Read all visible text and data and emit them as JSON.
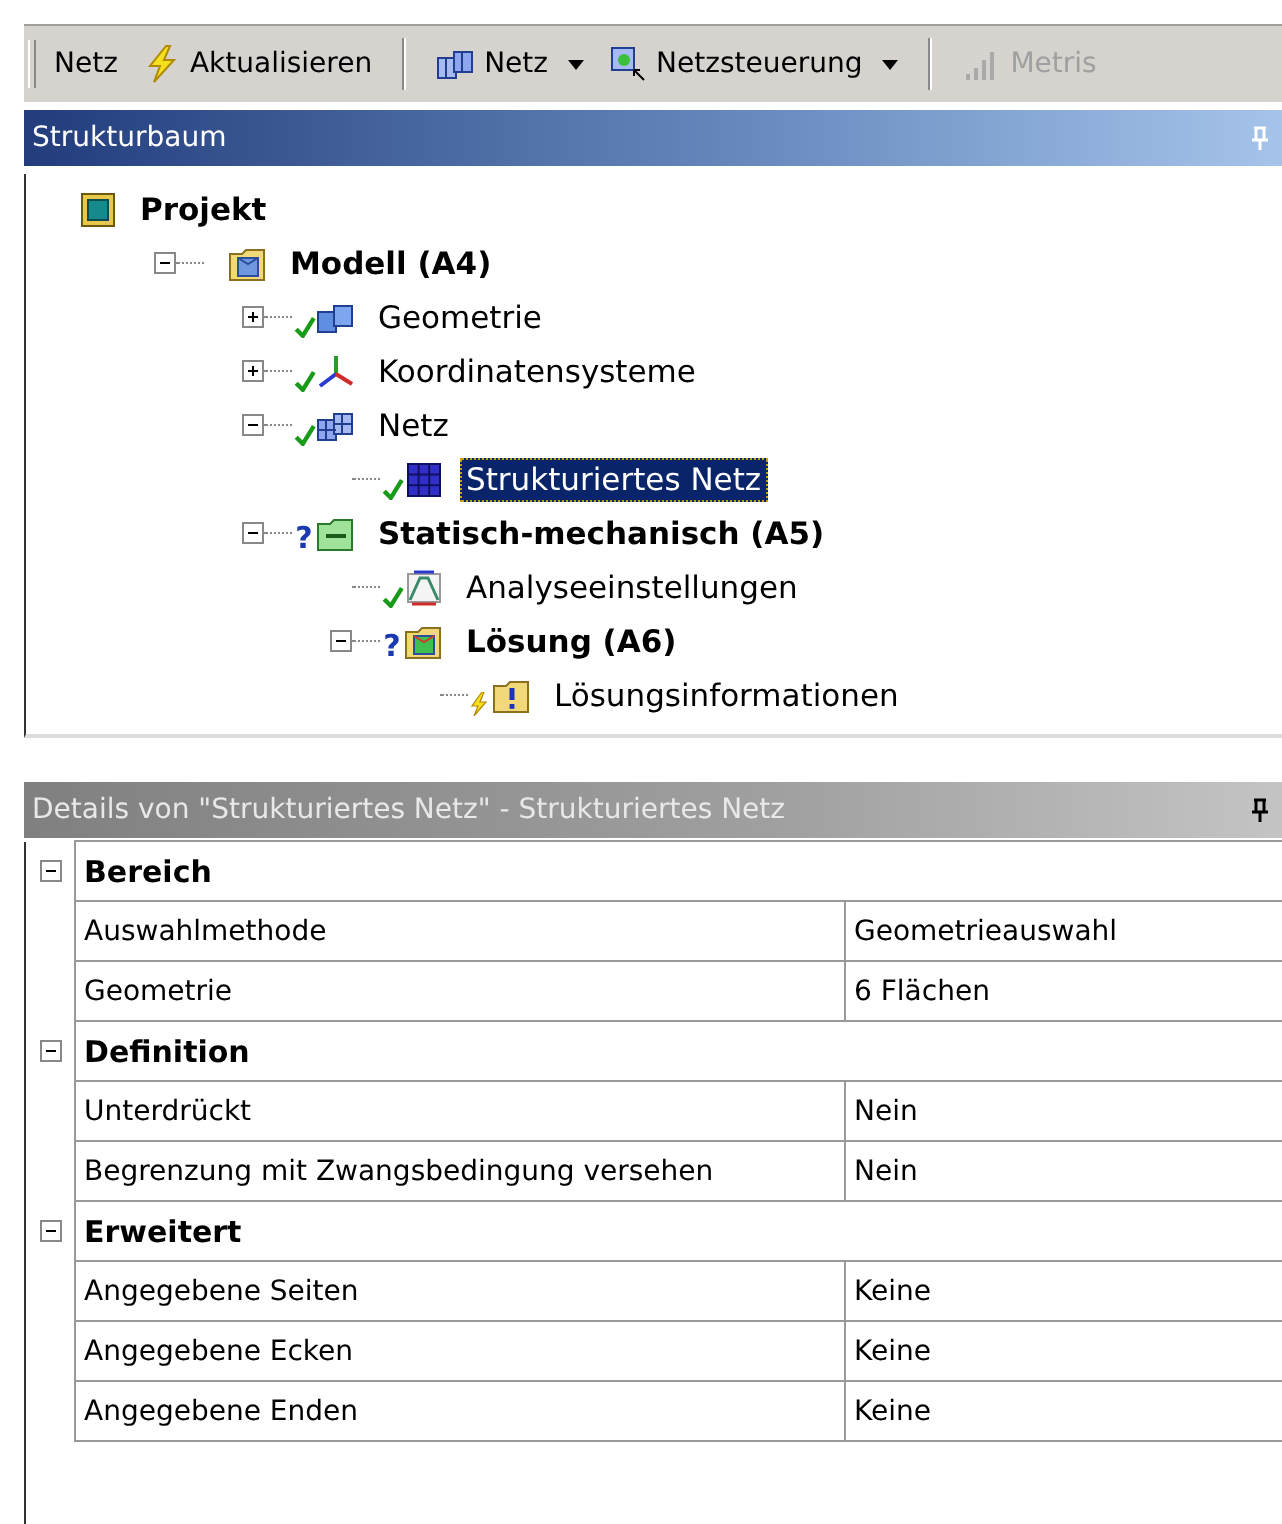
{
  "toolbar": {
    "groups": [
      [
        {
          "label": "Netz",
          "kind": "plain",
          "disabled": false
        },
        {
          "label": "Aktualisieren",
          "kind": "lightning",
          "disabled": false
        }
      ],
      [
        {
          "label": "Netz",
          "kind": "mesh-menu",
          "disabled": false
        },
        {
          "label": "Netzsteuerung",
          "kind": "control-menu",
          "disabled": false
        }
      ],
      [
        {
          "label": "Metris",
          "kind": "metric",
          "disabled": true
        }
      ]
    ]
  },
  "tree_panel": {
    "title": "Strukturbaum"
  },
  "tree": [
    {
      "label": "Projekt",
      "kind": "project",
      "bold": true,
      "selected": false,
      "children": [
        {
          "label": "Modell (A4)",
          "kind": "model",
          "bold": true,
          "selected": false,
          "expanded": true,
          "children": [
            {
              "label": "Geometrie",
              "kind": "geometry",
              "solved": true,
              "bold": false,
              "selected": false,
              "expanded": false
            },
            {
              "label": "Koordinatensysteme",
              "kind": "axes",
              "solved": true,
              "bold": false,
              "selected": false,
              "expanded": false
            },
            {
              "label": "Netz",
              "kind": "mesh",
              "solved": true,
              "bold": false,
              "selected": false,
              "expanded": true,
              "children": [
                {
                  "label": "Strukturiertes Netz",
                  "kind": "grid",
                  "solved": true,
                  "bold": false,
                  "selected": true
                }
              ]
            },
            {
              "label": "Statisch-mechanisch (A5)",
              "kind": "analysis",
              "flag": "?",
              "bold": true,
              "selected": false,
              "expanded": true,
              "children": [
                {
                  "label": "Analyseeinstellungen",
                  "kind": "settings",
                  "solved": true,
                  "bold": false,
                  "selected": false
                },
                {
                  "label": "Lösung (A6)",
                  "kind": "solution",
                  "flag": "?",
                  "bold": true,
                  "selected": false,
                  "expanded": true,
                  "children": [
                    {
                      "label": "Lösungsinformationen",
                      "kind": "info",
                      "outdated": true,
                      "bold": false,
                      "selected": false
                    }
                  ]
                }
              ]
            }
          ]
        }
      ]
    }
  ],
  "details_panel": {
    "title": "Details von \"Strukturiertes Netz\" - Strukturiertes Netz"
  },
  "details": [
    {
      "name": "Bereich",
      "expanded": true,
      "rows": [
        {
          "label": "Auswahlmethode",
          "value": "Geometrieauswahl"
        },
        {
          "label": "Geometrie",
          "value": "6 Flächen"
        }
      ]
    },
    {
      "name": "Definition",
      "expanded": true,
      "rows": [
        {
          "label": "Unterdrückt",
          "value": "Nein"
        },
        {
          "label": "Begrenzung mit Zwangsbedingung versehen",
          "value": "Nein"
        }
      ]
    },
    {
      "name": "Erweitert",
      "expanded": true,
      "rows": [
        {
          "label": "Angegebene Seiten",
          "value": "Keine"
        },
        {
          "label": "Angegebene Ecken",
          "value": "Keine"
        },
        {
          "label": "Angegebene Enden",
          "value": "Keine"
        }
      ]
    }
  ]
}
